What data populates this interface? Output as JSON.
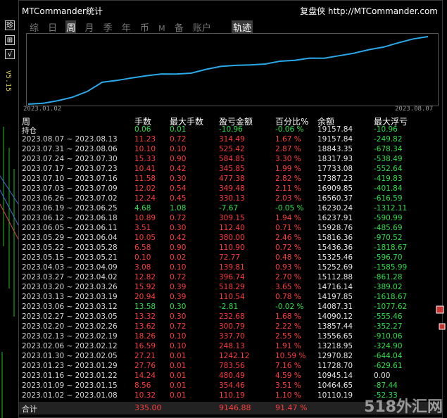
{
  "app": {
    "title": "MTCommander统计",
    "brand": "复盘侠 http://MTCommander.com"
  },
  "tabs": [
    {
      "label": "综",
      "active": false
    },
    {
      "label": "日",
      "active": false
    },
    {
      "label": "周",
      "active": true
    },
    {
      "label": "月",
      "active": false
    },
    {
      "label": "季",
      "active": false
    },
    {
      "label": "年",
      "active": false
    },
    {
      "label": "币",
      "active": false
    },
    {
      "label": "M",
      "active": false
    },
    {
      "label": "备",
      "active": false
    },
    {
      "label": "账户",
      "active": false
    }
  ],
  "trace_tab": "轨迹",
  "left_strip": {
    "btn1": "珍",
    "btn2": "⊞",
    "btn3": "√",
    "version": "V5.15"
  },
  "equity_chart": {
    "x_start_label": "2023.01.02",
    "x_end_label": "2023.08.07",
    "line_color": "#2aa8e8",
    "balance_series": [
      10000.0,
      10110.19,
      10464.65,
      10945.14,
      11728.7,
      12970.82,
      13218.95,
      13556.65,
      13857.44,
      14090.12,
      14087.31,
      14197.85,
      14716.14,
      15112.88,
      15252.69,
      15325.46,
      15436.36,
      15816.36,
      15928.76,
      16237.91,
      16230.24,
      16560.37,
      16909.85,
      17387.23,
      17733.08,
      18317.93,
      18843.35,
      19157.84
    ]
  },
  "colors": {
    "profit": "#ff3c3c",
    "loss": "#2ee04a"
  },
  "table": {
    "headers": [
      "周",
      "手数",
      "最大手数",
      "盈亏金额",
      "百分比%",
      "余额",
      "最大浮亏"
    ],
    "holding": {
      "label": "持仓",
      "lots": "0.06",
      "max_lots": "0.01",
      "pnl": "-10.96",
      "pct": "-0.06 %",
      "balance": "19157.84",
      "max_float": "-10.96"
    },
    "rows": [
      {
        "period": "2023.08.07 ~ 2023.08.13",
        "lots": "11.23",
        "max_lots": "0.72",
        "pnl": "314.49",
        "pct": "1.67 %",
        "balance": "19157.84",
        "max_float": "-249.82",
        "loss": false
      },
      {
        "period": "2023.07.31 ~ 2023.08.06",
        "lots": "10.10",
        "max_lots": "0.10",
        "pnl": "525.42",
        "pct": "2.87 %",
        "balance": "18843.35",
        "max_float": "-678.34",
        "loss": false
      },
      {
        "period": "2023.07.24 ~ 2023.07.30",
        "lots": "15.33",
        "max_lots": "0.90",
        "pnl": "584.85",
        "pct": "3.30 %",
        "balance": "18317.93",
        "max_float": "-538.49",
        "loss": false
      },
      {
        "period": "2023.07.17 ~ 2023.07.23",
        "lots": "10.41",
        "max_lots": "0.42",
        "pnl": "345.85",
        "pct": "1.99 %",
        "balance": "17733.08",
        "max_float": "-552.64",
        "loss": false
      },
      {
        "period": "2023.07.10 ~ 2023.07.16",
        "lots": "11.58",
        "max_lots": "0.30",
        "pnl": "477.38",
        "pct": "2.82 %",
        "balance": "17387.23",
        "max_float": "-419.83",
        "loss": false
      },
      {
        "period": "2023.07.03 ~ 2023.07.09",
        "lots": "12.02",
        "max_lots": "0.54",
        "pnl": "349.48",
        "pct": "2.11 %",
        "balance": "16909.85",
        "max_float": "-401.84",
        "loss": false
      },
      {
        "period": "2023.06.26 ~ 2023.07.02",
        "lots": "12.24",
        "max_lots": "0.45",
        "pnl": "330.13",
        "pct": "2.03 %",
        "balance": "16560.37",
        "max_float": "-616.59",
        "loss": false
      },
      {
        "period": "2023.06.19 ~ 2023.06.25",
        "lots": "4.68",
        "max_lots": "1.08",
        "pnl": "-7.67",
        "pct": "-0.05 %",
        "balance": "16230.24",
        "max_float": "-1312.11",
        "loss": true
      },
      {
        "period": "2023.06.12 ~ 2023.06.18",
        "lots": "10.89",
        "max_lots": "0.72",
        "pnl": "309.15",
        "pct": "1.94 %",
        "balance": "16237.91",
        "max_float": "-590.99",
        "loss": false
      },
      {
        "period": "2023.06.05 ~ 2023.06.11",
        "lots": "3.51",
        "max_lots": "0.30",
        "pnl": "112.40",
        "pct": "0.71 %",
        "balance": "15928.76",
        "max_float": "-485.69",
        "loss": false
      },
      {
        "period": "2023.05.29 ~ 2023.06.04",
        "lots": "10.05",
        "max_lots": "0.42",
        "pnl": "380.00",
        "pct": "2.46 %",
        "balance": "15816.36",
        "max_float": "-970.52",
        "loss": false
      },
      {
        "period": "2023.05.22 ~ 2023.05.28",
        "lots": "6.58",
        "max_lots": "0.90",
        "pnl": "110.90",
        "pct": "0.72 %",
        "balance": "15436.36",
        "max_float": "-1818.67",
        "loss": false
      },
      {
        "period": "2023.05.15 ~ 2023.05.21",
        "lots": "0.10",
        "max_lots": "0.02",
        "pnl": "72.77",
        "pct": "0.48 %",
        "balance": "15325.46",
        "max_float": "-596.70",
        "loss": false
      },
      {
        "period": "2023.04.03 ~ 2023.04.09",
        "lots": "3.08",
        "max_lots": "0.10",
        "pnl": "139.81",
        "pct": "0.93 %",
        "balance": "15252.69",
        "max_float": "-1585.99",
        "loss": false
      },
      {
        "period": "2023.03.27 ~ 2023.04.02",
        "lots": "12.82",
        "max_lots": "0.72",
        "pnl": "396.74",
        "pct": "2.70 %",
        "balance": "15112.88",
        "max_float": "-861.28",
        "loss": false
      },
      {
        "period": "2023.03.20 ~ 2023.03.26",
        "lots": "15.92",
        "max_lots": "0.39",
        "pnl": "518.29",
        "pct": "3.65 %",
        "balance": "14716.14",
        "max_float": "-389.02",
        "loss": false
      },
      {
        "period": "2023.03.13 ~ 2023.03.19",
        "lots": "20.94",
        "max_lots": "0.39",
        "pnl": "110.54",
        "pct": "0.78 %",
        "balance": "14197.85",
        "max_float": "-1618.67",
        "loss": false
      },
      {
        "period": "2023.03.06 ~ 2023.03.12",
        "lots": "13.58",
        "max_lots": "0.30",
        "pnl": "-2.81",
        "pct": "-0.02 %",
        "balance": "14087.31",
        "max_float": "-1077.62",
        "loss": true
      },
      {
        "period": "2023.02.27 ~ 2023.03.05",
        "lots": "13.32",
        "max_lots": "0.30",
        "pnl": "232.68",
        "pct": "1.68 %",
        "balance": "14090.12",
        "max_float": "-555.46",
        "loss": false
      },
      {
        "period": "2023.02.20 ~ 2023.02.26",
        "lots": "13.62",
        "max_lots": "0.72",
        "pnl": "300.79",
        "pct": "2.22 %",
        "balance": "13857.44",
        "max_float": "-352.27",
        "loss": false
      },
      {
        "period": "2023.02.13 ~ 2023.02.19",
        "lots": "18.26",
        "max_lots": "0.10",
        "pnl": "337.70",
        "pct": "2.55 %",
        "balance": "13556.65",
        "max_float": "-910.06",
        "loss": false
      },
      {
        "period": "2023.02.06 ~ 2023.02.12",
        "lots": "16.59",
        "max_lots": "0.10",
        "pnl": "248.13",
        "pct": "1.91 %",
        "balance": "13218.95",
        "max_float": "-324.90",
        "loss": false
      },
      {
        "period": "2023.01.30 ~ 2023.02.05",
        "lots": "27.21",
        "max_lots": "0.01",
        "pnl": "1242.12",
        "pct": "10.59 %",
        "balance": "12970.82",
        "max_float": "-644.04",
        "loss": false
      },
      {
        "period": "2023.01.23 ~ 2023.01.29",
        "lots": "27.76",
        "max_lots": "0.01",
        "pnl": "783.56",
        "pct": "7.16 %",
        "balance": "11728.70",
        "max_float": "-629.61",
        "loss": false
      },
      {
        "period": "2023.01.16 ~ 2023.01.22",
        "lots": "14.24",
        "max_lots": "0.01",
        "pnl": "480.49",
        "pct": "4.59 %",
        "balance": "10945.14",
        "max_float": "0.00",
        "loss": false
      },
      {
        "period": "2023.01.09 ~ 2023.01.15",
        "lots": "8.56",
        "max_lots": "0.01",
        "pnl": "354.46",
        "pct": "3.51 %",
        "balance": "10464.65",
        "max_float": "-87.44",
        "loss": false
      },
      {
        "period": "2023.01.02 ~ 2023.01.08",
        "lots": "10.32",
        "max_lots": "0.01",
        "pnl": "110.19",
        "pct": "1.10 %",
        "balance": "10110.19",
        "max_float": "-52.33",
        "loss": false
      }
    ],
    "total": {
      "label": "合计",
      "lots": "335.00",
      "pnl": "9146.88",
      "pct": "91.47 %"
    }
  },
  "watermark": "518外汇网"
}
